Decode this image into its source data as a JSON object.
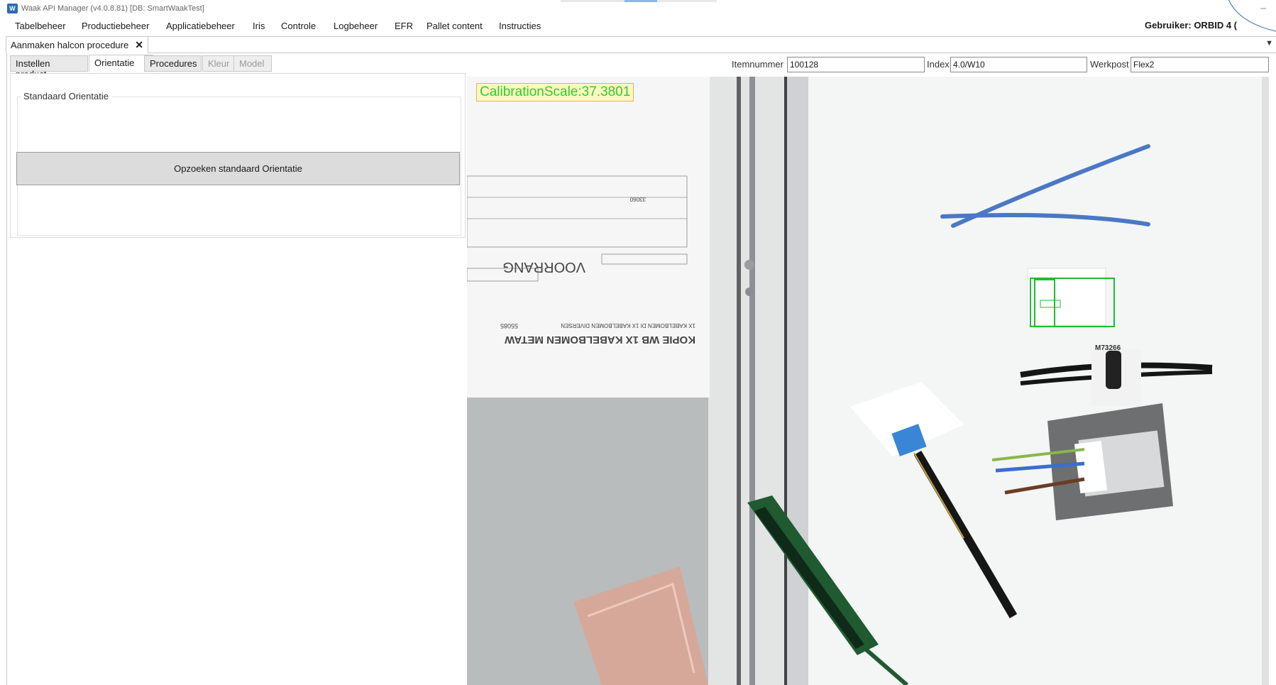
{
  "window": {
    "title": "Waak API Manager (v4.0.8.81) [DB: SmartWaakTest]",
    "app_icon": "app-logo-icon"
  },
  "menu": {
    "items": [
      "Tabelbeheer",
      "Productiebeheer",
      "Applicatiebeheer",
      "Iris",
      "Controle",
      "Logbeheer",
      "EFR",
      "Pallet content",
      "Instructies"
    ],
    "user": "Gebruiker: ORBID 4 ("
  },
  "document_tab": {
    "label": "Aanmaken halcon procedure",
    "close": "✕",
    "menu_icon": "⇅"
  },
  "subtabs": {
    "items": [
      {
        "label": "Instellen product",
        "state": "normal"
      },
      {
        "label": "Orientatie",
        "state": "active"
      },
      {
        "label": "Procedures",
        "state": "normal"
      },
      {
        "label": "Kleur",
        "state": "disabled"
      },
      {
        "label": "Model",
        "state": "disabled"
      }
    ]
  },
  "fields": {
    "itemnummer_label": "Itemnummer",
    "itemnummer_value": "100128",
    "index_label": "Index",
    "index_value": "4.0/W10",
    "werkpost_label": "Werkpost",
    "werkpost_value": "Flex2"
  },
  "orientation_panel": {
    "group_title": "Standaard Orientatie",
    "lookup_button": "Opzoeken standaard Orientatie"
  },
  "camera": {
    "calibration": "CalibrationScale:37.3801",
    "overlay_color": "#2fcc2f",
    "document_text": {
      "header": "KOPIE WB    1X KABELBOMEN    METAW",
      "subtitle": "1X KABELBOMEN DI 1X KABELBOMEN DIVERSEN",
      "code": "55085",
      "stamp": "VOORRANG",
      "number": "33060"
    },
    "label_text": "M73266"
  }
}
